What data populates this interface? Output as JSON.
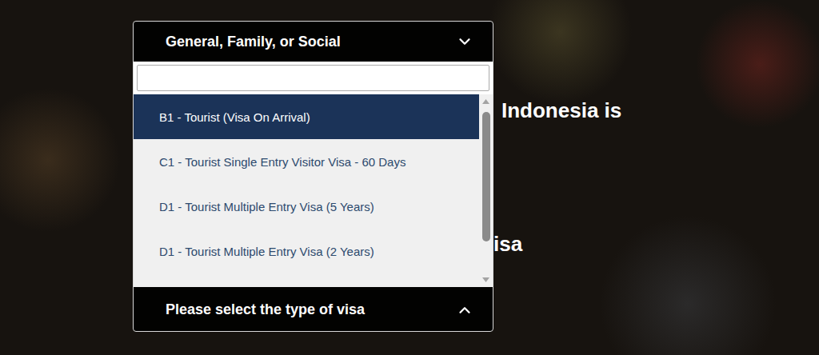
{
  "background_heading": [
    "Indonesia is",
    "isa"
  ],
  "visa_category": {
    "value": "General, Family, or Social",
    "expanded": true
  },
  "search": {
    "value": ""
  },
  "options": [
    {
      "label": "B1 - Tourist (Visa On Arrival)",
      "selected": true
    },
    {
      "label": "C1 - Tourist Single Entry Visitor Visa - 60 Days",
      "selected": false
    },
    {
      "label": "D1 - Tourist Multiple Entry Visa (5 Years)",
      "selected": false
    },
    {
      "label": "D1 - Tourist Multiple Entry Visa (2 Years)",
      "selected": false
    }
  ],
  "scrollbar": {
    "level": 0.8
  },
  "visa_type": {
    "placeholder": "Please select the type of visa",
    "expanded": true
  }
}
